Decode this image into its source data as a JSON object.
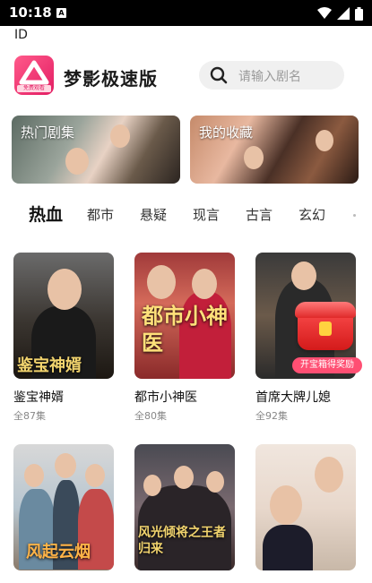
{
  "status_bar": {
    "time": "10:18",
    "sim_icon": "A"
  },
  "id_label": "ID",
  "header": {
    "app_name": "梦影极速版",
    "logo_tag": "免费观看",
    "search_placeholder": "请输入剧名"
  },
  "banners": [
    {
      "label": "热门剧集"
    },
    {
      "label": "我的收藏"
    }
  ],
  "tabs": [
    "热血",
    "都市",
    "悬疑",
    "现言",
    "古言",
    "玄幻"
  ],
  "active_tab": "热血",
  "dramas": [
    {
      "title": "鉴宝神婿",
      "episodes": "全87集",
      "poster_text": "鉴宝神婿"
    },
    {
      "title": "都市小神医",
      "episodes": "全80集",
      "poster_text": "都市小神医"
    },
    {
      "title": "首席大牌儿媳",
      "episodes": "全92集",
      "poster_text": ""
    },
    {
      "title": "",
      "episodes": "",
      "poster_text": "风起云烟"
    },
    {
      "title": "",
      "episodes": "",
      "poster_text": "风光倾将之王者归来"
    },
    {
      "title": "",
      "episodes": "",
      "poster_text": ""
    }
  ],
  "reward_badge": {
    "label": "开宝箱得奖励"
  },
  "colors": {
    "accent": "#e31e64",
    "reward": "#ff4f73"
  }
}
